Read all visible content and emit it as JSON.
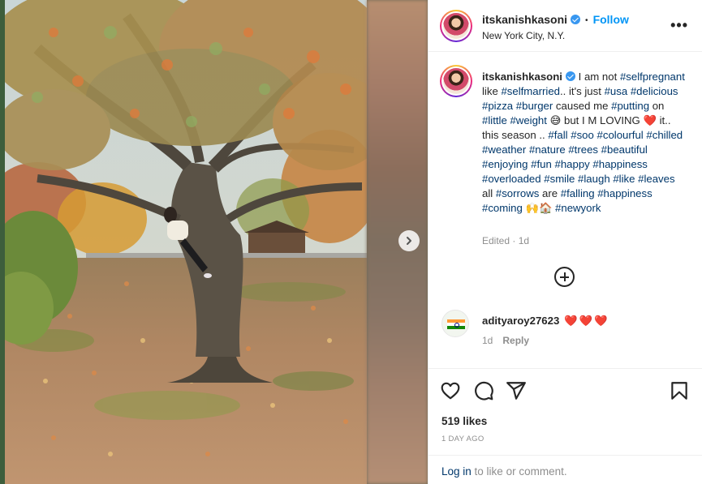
{
  "post": {
    "username": "itskanishkasoni",
    "follow_label": "Follow",
    "location": "New York City, N.Y.",
    "more_label": "•••"
  },
  "caption": {
    "username": "itskanishkasoni",
    "segments": [
      {
        "t": " I am not "
      },
      {
        "t": "#selfpregnant",
        "tag": true
      },
      {
        "t": " like "
      },
      {
        "t": "#selfmarried",
        "tag": true
      },
      {
        "t": ".. it's just "
      },
      {
        "t": "#usa",
        "tag": true
      },
      {
        "t": " "
      },
      {
        "t": "#delicious",
        "tag": true
      },
      {
        "t": " "
      },
      {
        "t": "#pizza",
        "tag": true
      },
      {
        "t": " "
      },
      {
        "t": "#burger",
        "tag": true
      },
      {
        "t": " caused me "
      },
      {
        "t": "#putting",
        "tag": true
      },
      {
        "t": " on "
      },
      {
        "t": "#little",
        "tag": true
      },
      {
        "t": " "
      },
      {
        "t": "#weight",
        "tag": true
      },
      {
        "t": " 😅 but I M LOVING ❤️ it.. this season .. "
      },
      {
        "t": "#fall",
        "tag": true
      },
      {
        "t": " "
      },
      {
        "t": "#soo",
        "tag": true
      },
      {
        "t": " "
      },
      {
        "t": "#colourful",
        "tag": true
      },
      {
        "t": " "
      },
      {
        "t": "#chilled",
        "tag": true
      },
      {
        "t": " "
      },
      {
        "t": "#weather",
        "tag": true
      },
      {
        "t": " "
      },
      {
        "t": "#nature",
        "tag": true
      },
      {
        "t": " "
      },
      {
        "t": "#trees",
        "tag": true
      },
      {
        "t": " "
      },
      {
        "t": "#beautiful",
        "tag": true
      },
      {
        "t": " "
      },
      {
        "t": "#enjoying",
        "tag": true
      },
      {
        "t": " "
      },
      {
        "t": "#fun",
        "tag": true
      },
      {
        "t": " "
      },
      {
        "t": "#happy",
        "tag": true
      },
      {
        "t": " "
      },
      {
        "t": "#happiness",
        "tag": true
      },
      {
        "t": " "
      },
      {
        "t": "#overloaded",
        "tag": true
      },
      {
        "t": " "
      },
      {
        "t": "#smile",
        "tag": true
      },
      {
        "t": " "
      },
      {
        "t": "#laugh",
        "tag": true
      },
      {
        "t": " "
      },
      {
        "t": "#like",
        "tag": true
      },
      {
        "t": " "
      },
      {
        "t": "#leaves",
        "tag": true
      },
      {
        "t": " all "
      },
      {
        "t": "#sorrows",
        "tag": true
      },
      {
        "t": " are "
      },
      {
        "t": "#falling",
        "tag": true
      },
      {
        "t": " "
      },
      {
        "t": "#happiness",
        "tag": true
      },
      {
        "t": " "
      },
      {
        "t": "#coming",
        "tag": true
      },
      {
        "t": " 🙌🏠 "
      },
      {
        "t": "#newyork",
        "tag": true
      }
    ],
    "edited": "Edited · 1d"
  },
  "comment": {
    "username": "adityaroy27623",
    "text": "❤️❤️❤️",
    "time": "1d",
    "reply_label": "Reply"
  },
  "stats": {
    "likes": "519 likes",
    "date": "1 DAY AGO"
  },
  "login": {
    "link": "Log in",
    "rest": " to like or comment."
  },
  "icons": {
    "verified": "verified-badge-icon",
    "next": "chevron-right-icon",
    "more": "more-options-icon",
    "load_more": "plus-circle-icon",
    "like": "heart-icon",
    "comment": "comment-icon",
    "share": "share-icon",
    "save": "bookmark-icon"
  },
  "colors": {
    "accent": "#0095f6",
    "hashtag": "#00376b",
    "muted": "#8e8e8e",
    "verified": "#3897f0",
    "heart": "#ed1c24"
  }
}
